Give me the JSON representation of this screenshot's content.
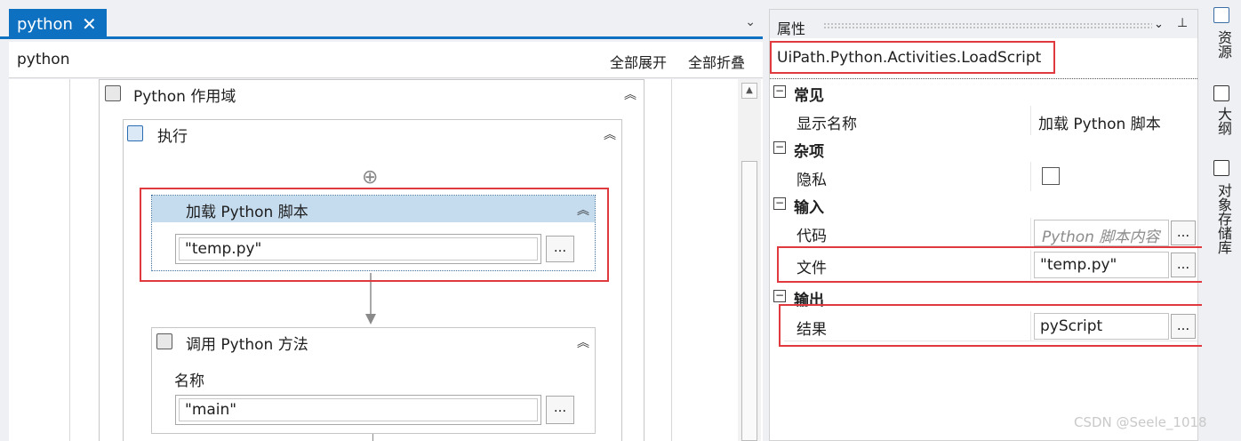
{
  "tab": {
    "title": "python",
    "close": "✕",
    "menu": "⌄"
  },
  "breadcrumb": {
    "label": "python",
    "expand_all": "全部展开",
    "collapse_all": "全部折叠"
  },
  "designer": {
    "scope": {
      "title": "Python 作用域",
      "collapse": "︽"
    },
    "exec": {
      "title": "执行",
      "collapse": "︽"
    },
    "add_icon": "⊕",
    "load_script": {
      "title": "加载 Python 脚本",
      "collapse": "︽",
      "file_value": "\"temp.py\"",
      "dots": "..."
    },
    "invoke_method": {
      "title": "调用 Python 方法",
      "collapse": "︽",
      "name_label": "名称",
      "name_value": "\"main\"",
      "dots": "..."
    }
  },
  "properties": {
    "title": "属性",
    "menu": "⌄",
    "pin": "⊥",
    "type": "UiPath.Python.Activities.LoadScript",
    "categories": {
      "common": {
        "label": "常见",
        "toggle": "−"
      },
      "misc": {
        "label": "杂项",
        "toggle": "−"
      },
      "input": {
        "label": "输入",
        "toggle": "−"
      },
      "output": {
        "label": "输出",
        "toggle": "−"
      }
    },
    "rows": {
      "display_name": {
        "label": "显示名称",
        "value": "加载 Python 脚本"
      },
      "private": {
        "label": "隐私"
      },
      "code": {
        "label": "代码",
        "placeholder": "Python 脚本内容",
        "dots": "..."
      },
      "file": {
        "label": "文件",
        "value": "\"temp.py\"",
        "dots": "..."
      },
      "result": {
        "label": "结果",
        "value": "pyScript",
        "dots": "..."
      }
    }
  },
  "right_strip": {
    "resources": "资源",
    "outline": "大纲",
    "object_repo": "对象存储库"
  },
  "watermark": "CSDN @Seele_1018",
  "colors": {
    "accent": "#0e70c0",
    "selected_header": "#c5dcef",
    "highlight": "#e0393e"
  }
}
